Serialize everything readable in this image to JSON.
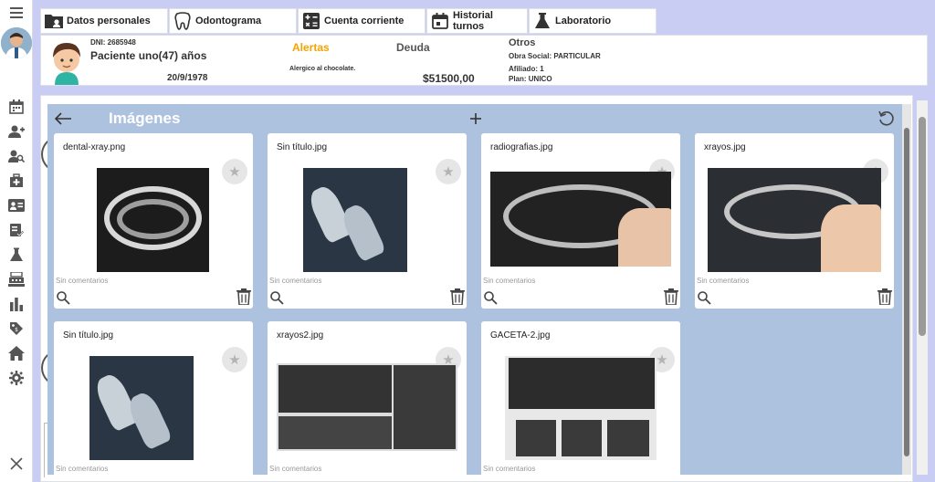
{
  "tabs": [
    {
      "label": "Datos personales",
      "icon": "folder-icon"
    },
    {
      "label": "Odontograma",
      "icon": "tooth-icon"
    },
    {
      "label": "Cuenta corriente",
      "icon": "calculator-icon"
    },
    {
      "label": "Historial turnos",
      "icon": "calendar-icon"
    },
    {
      "label": "Laboratorio",
      "icon": "flask-icon"
    }
  ],
  "patient": {
    "dni": "DNI: 2685948",
    "name": "Paciente uno(47) años",
    "birthdate": "20/9/1978",
    "alerts_title": "Alertas",
    "alerts_text": "Alergico al chocolate.",
    "debt_title": "Deuda",
    "debt_value": "$51500,00",
    "others_title": "Otros",
    "obra_social": "Obra Social: PARTICULAR",
    "afiliado": "Afiliado: 1",
    "plan": "Plan: UNICO"
  },
  "sidebar": {
    "menu_icon": "hamburger-icon",
    "items": [
      "calendar-icon",
      "add-user-icon",
      "search-user-icon",
      "first-aid-icon",
      "id-card-icon",
      "checklist-icon",
      "flask-icon",
      "cash-register-icon",
      "bar-chart-icon",
      "tag-icon",
      "home-icon",
      "gear-icon"
    ],
    "close_icon": "close-icon"
  },
  "modal": {
    "title": "Imágenes",
    "images": [
      {
        "name": "dental-xray.png",
        "comment": "Sin comentarios"
      },
      {
        "name": "Sin título.jpg",
        "comment": "Sin comentarios"
      },
      {
        "name": "radiografias.jpg",
        "comment": "Sin comentarios"
      },
      {
        "name": "xrayos.jpg",
        "comment": "Sin comentarios"
      },
      {
        "name": "Sin título.jpg",
        "comment": "Sin comentarios"
      },
      {
        "name": "xrayos2.jpg",
        "comment": "Sin comentarios"
      },
      {
        "name": "GACETA-2.jpg",
        "comment": "Sin comentarios"
      }
    ]
  },
  "colors": {
    "accent_alert": "#f5a300",
    "modal_bg": "#adc2de",
    "page_bg": "#c9cdf3"
  }
}
